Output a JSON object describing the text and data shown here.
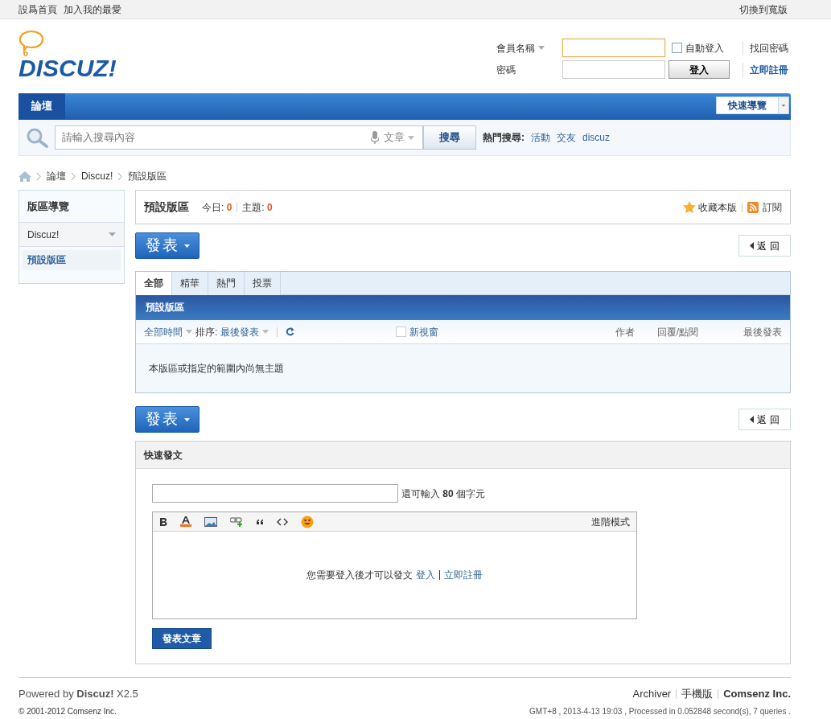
{
  "topbar": {
    "links": [
      "設爲首頁",
      "加入我的最愛"
    ],
    "wide_link": "切換到寬版"
  },
  "logo": {
    "text": "DISCUZ!"
  },
  "login": {
    "username_label": "會員名稱",
    "auto_login": {
      "label": "自動登入",
      "checked": false
    },
    "password_label": "密碼",
    "login_button": "登入",
    "forgot": "找回密碼",
    "register": "立即註冊"
  },
  "nav": {
    "items": [
      {
        "label": "論壇",
        "selected": true
      }
    ],
    "quick_nav": "快速導覽"
  },
  "search": {
    "placeholder": "請輸入搜尋內容",
    "type": "文章",
    "button": "搜尋",
    "hot_label": "熱門搜尋:",
    "hot": [
      "活動",
      "交友",
      "discuz"
    ]
  },
  "breadcrumb": [
    "論壇",
    "Discuz!",
    "預設版區"
  ],
  "sidebar": {
    "title": "版區導覽",
    "groups": [
      {
        "label": "Discuz!",
        "expanded": true,
        "children": [
          {
            "label": "預設版區",
            "selected": true
          }
        ]
      }
    ]
  },
  "forum_header": {
    "title": "預設版區",
    "stats": [
      {
        "label": "今日:",
        "value": "0"
      },
      {
        "label": "主題:",
        "value": "0"
      }
    ],
    "actions": [
      {
        "kind": "star",
        "label": "收藏本版"
      },
      {
        "kind": "rss",
        "label": "訂閱"
      }
    ]
  },
  "toolbar_top": {
    "post": "發表",
    "back": "返 回"
  },
  "thread_list": {
    "tabs": [
      {
        "label": "全部",
        "selected": true
      },
      {
        "label": "精華",
        "selected": false
      },
      {
        "label": "熱門",
        "selected": false
      },
      {
        "label": "投票",
        "selected": false
      }
    ],
    "title": "預設版區",
    "time_filter": "全部時間",
    "sort_label": "排序:",
    "sort": "最後發表",
    "new_window": {
      "label": "新視窗",
      "checked": false
    },
    "columns": [
      "作者",
      "回覆/點閱",
      "最後發表"
    ],
    "empty": "本版區或指定的範圍內尚無主題"
  },
  "toolbar_bottom": {
    "post": "發表",
    "back": "返 回"
  },
  "quick_post": {
    "title": "快速發文",
    "remaining": "還可輸入 **80** 個字元",
    "tools": [
      {
        "kind": "bold"
      },
      {
        "kind": "color"
      },
      {
        "kind": "image"
      },
      {
        "kind": "link"
      },
      {
        "kind": "quote"
      },
      {
        "kind": "code"
      },
      {
        "kind": "smiley"
      }
    ],
    "advanced": "進階模式",
    "notice": "您需要登入後才可以發文",
    "login_link": "登入",
    "register_link": "立即註冊",
    "submit": "發表文章"
  },
  "footer": {
    "powered": "Powered by **Discuz!** X2.5",
    "copyright": "© 2001-2012 Comsenz Inc.",
    "links": [
      {
        "label": "Archiver",
        "bold": false
      },
      {
        "label": "手機版",
        "bold": false
      },
      {
        "label": "Comsenz Inc.",
        "bold": true
      }
    ],
    "status": "GMT+8 , 2013-4-13 19:03 , Processed in 0.052848 second(s), 7 queries ."
  }
}
